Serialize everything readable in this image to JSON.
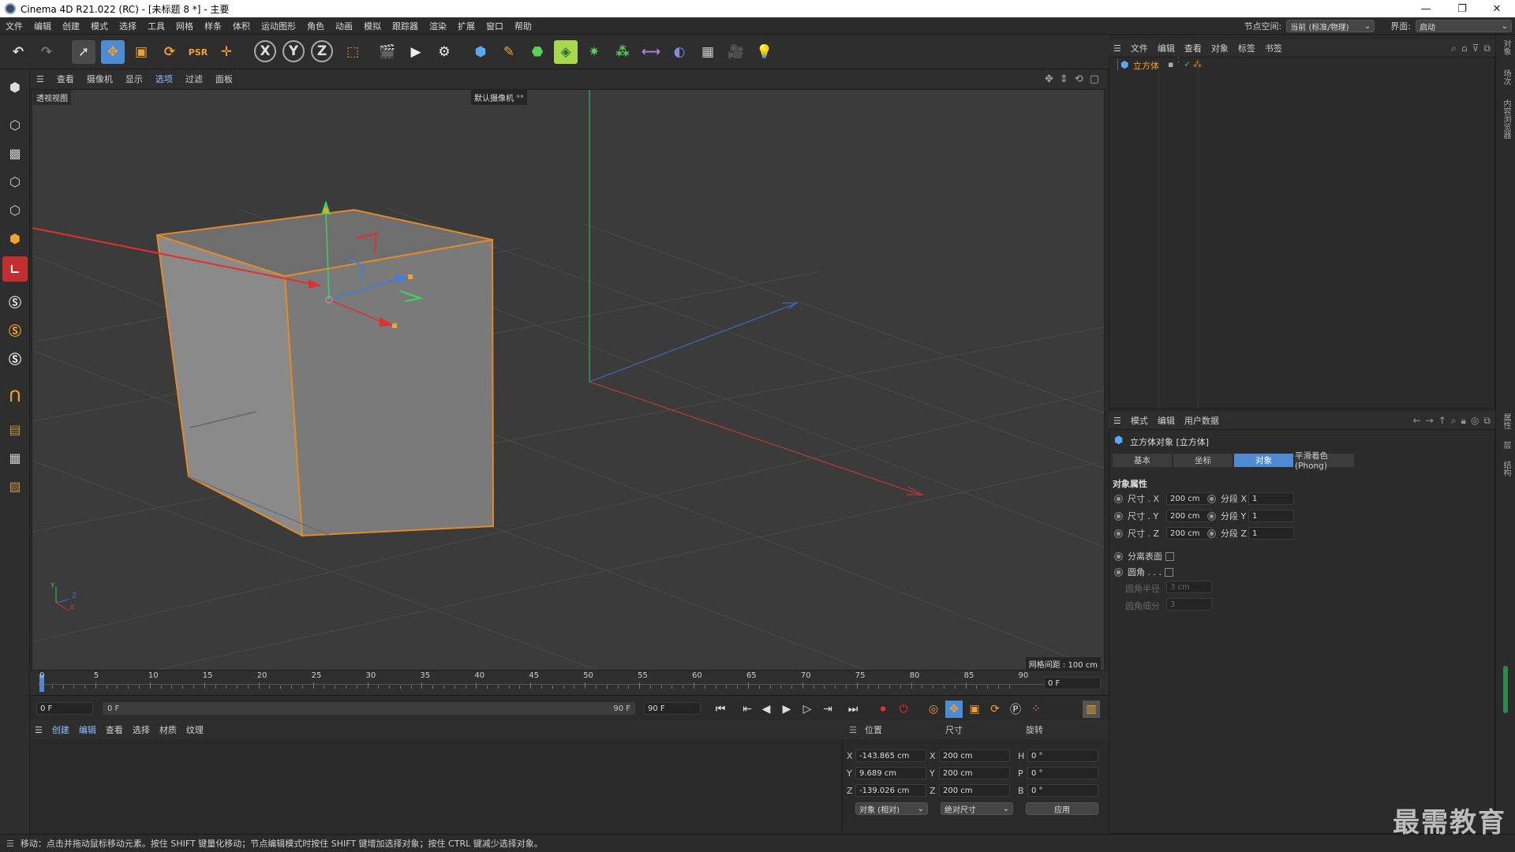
{
  "window": {
    "title": "Cinema 4D R21.022 (RC) - [未标题 8 *] - 主要",
    "min": "—",
    "max": "❐",
    "close": "✕"
  },
  "menu": {
    "items": [
      "文件",
      "编辑",
      "创建",
      "模式",
      "选择",
      "工具",
      "网格",
      "样条",
      "体积",
      "运动图形",
      "角色",
      "动画",
      "模拟",
      "跟踪器",
      "渲染",
      "扩展",
      "窗口",
      "帮助"
    ],
    "node_space_label": "节点空间:",
    "node_space_value": "当前 (标准/物理)",
    "interface_label": "界面:",
    "interface_value": "启动"
  },
  "viewport": {
    "menu": [
      "查看",
      "摄像机",
      "显示",
      "选项",
      "过滤",
      "面板"
    ],
    "name": "透视视图",
    "camera": "默认摄像机 °°",
    "grid_spacing": "网格间距 : 100 cm",
    "axis_labels": {
      "y": "Y",
      "z": "Z",
      "x": "X"
    }
  },
  "timeline": {
    "ticks": [
      "0",
      "5",
      "10",
      "15",
      "20",
      "25",
      "30",
      "35",
      "40",
      "45",
      "50",
      "55",
      "60",
      "65",
      "70",
      "75",
      "80",
      "85",
      "90"
    ],
    "current_frame": "0 F",
    "start": "0 F",
    "range_start": "0 F",
    "range_end": "90 F",
    "end": "90 F"
  },
  "material_menu": [
    "创建",
    "编辑",
    "查看",
    "选择",
    "材质",
    "纹理"
  ],
  "coords": {
    "headers": {
      "pos": "位置",
      "size": "尺寸",
      "rot": "旋转"
    },
    "rows": [
      {
        "axis": "X",
        "pos": "-143.865 cm",
        "saxis": "X",
        "size": "200 cm",
        "raxis": "H",
        "rot": "0 °"
      },
      {
        "axis": "Y",
        "pos": "9.689 cm",
        "saxis": "Y",
        "size": "200 cm",
        "raxis": "P",
        "rot": "0 °"
      },
      {
        "axis": "Z",
        "pos": "-139.026 cm",
        "saxis": "Z",
        "size": "200 cm",
        "raxis": "B",
        "rot": "0 °"
      }
    ],
    "mode1": "对象 (相对)",
    "mode2": "绝对尺寸",
    "apply": "应用"
  },
  "object_manager": {
    "menu": [
      "文件",
      "编辑",
      "查看",
      "对象",
      "标签",
      "书签"
    ],
    "items": [
      {
        "name": "立方体"
      }
    ]
  },
  "attributes": {
    "menu": [
      "模式",
      "编辑",
      "用户数据"
    ],
    "title": "立方体对象 [立方体]",
    "tabs": [
      "基本",
      "坐标",
      "对象",
      "平滑着色(Phong)"
    ],
    "active_tab": "对象",
    "section": "对象属性",
    "props": [
      {
        "label": "尺寸 . X",
        "value": "200 cm",
        "label2": "分段 X",
        "value2": "1"
      },
      {
        "label": "尺寸 . Y",
        "value": "200 cm",
        "label2": "分段 Y",
        "value2": "1"
      },
      {
        "label": "尺寸 . Z",
        "value": "200 cm",
        "label2": "分段 Z",
        "value2": "1"
      }
    ],
    "separate_surfaces": "分离表面",
    "fillet": "圆角 . . .",
    "fillet_radius": "圆角半径",
    "fillet_radius_value": "3 cm",
    "fillet_subdiv": "圆角细分",
    "fillet_subdiv_value": "3"
  },
  "side_tabs": [
    "对象",
    "场次",
    "内容浏览器"
  ],
  "side_tabs2": [
    "属性",
    "层",
    "结构"
  ],
  "status": "移动：点击并拖动鼠标移动元素。按住 SHIFT 键量化移动；节点编辑模式时按住 SHIFT 键增加选择对象；按住 CTRL 键减少选择对象。",
  "watermark": "最需教育",
  "colors": {
    "accent": "#4e8bd3",
    "selection": "#e08a2b",
    "x_axis": "#e03030",
    "y_axis": "#30c040",
    "z_axis": "#3070d0"
  }
}
